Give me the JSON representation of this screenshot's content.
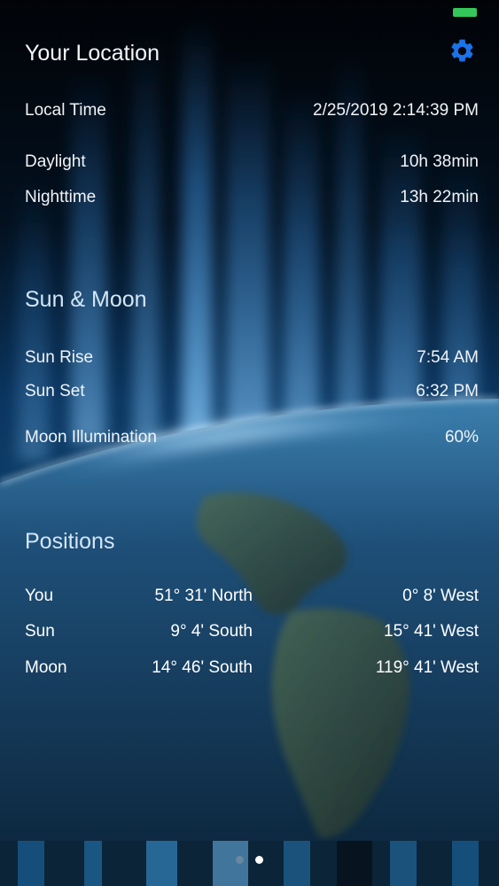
{
  "header": {
    "title": "Your Location",
    "settings_icon": "gear-icon"
  },
  "time": {
    "local_time_label": "Local Time",
    "local_time_value": "2/25/2019 2:14:39 PM",
    "daylight_label": "Daylight",
    "daylight_value": "10h 38min",
    "nighttime_label": "Nighttime",
    "nighttime_value": "13h 22min"
  },
  "sun_moon": {
    "title": "Sun & Moon",
    "sunrise_label": "Sun Rise",
    "sunrise_value": "7:54 AM",
    "sunset_label": "Sun Set",
    "sunset_value": "6:32 PM",
    "moon_label": "Moon Illumination",
    "moon_value": "60%"
  },
  "positions": {
    "title": "Positions",
    "rows": [
      {
        "name": "You",
        "lat": "51° 31' North",
        "lon": "0° 8' West"
      },
      {
        "name": "Sun",
        "lat": "9° 4' South",
        "lon": "15° 41' West"
      },
      {
        "name": "Moon",
        "lat": "14° 46' South",
        "lon": "119° 41' West"
      }
    ]
  },
  "pager": {
    "page_count": 2,
    "active_page": 2
  },
  "colors": {
    "accent": "#1a73e8",
    "battery": "#34c759"
  }
}
